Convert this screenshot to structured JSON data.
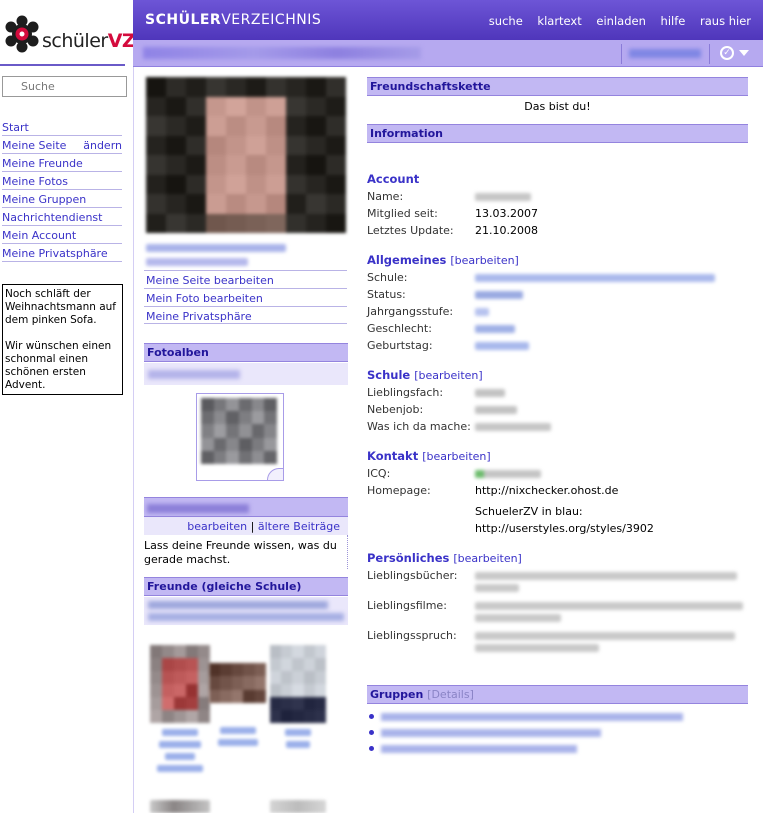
{
  "logo": {
    "prefix": "schüler",
    "suffix": "VZ"
  },
  "search": {
    "placeholder": "Suche"
  },
  "leftnav": {
    "items": [
      {
        "label": "Start"
      },
      {
        "label": "Meine Seite",
        "aside": "ändern"
      },
      {
        "label": "Meine Freunde"
      },
      {
        "label": "Meine Fotos"
      },
      {
        "label": "Meine Gruppen"
      },
      {
        "label": "Nachrichtendienst"
      },
      {
        "label": "Mein Account"
      },
      {
        "label": "Meine Privatsphäre"
      }
    ]
  },
  "note": {
    "para1": "Noch schläft der Weihnachtsmann auf dem pinken Sofa.",
    "para2": "Wir wünschen einen schonmal einen schönen ersten Advent."
  },
  "header": {
    "brand_bold": "SCHÜLER",
    "brand_rest": "VERZEICHNIS",
    "nav": [
      "suche",
      "klartext",
      "einladen",
      "hilfe",
      "raus hier"
    ]
  },
  "profile_links": [
    "Meine Seite bearbeiten",
    "Mein Foto bearbeiten",
    "Meine Privatsphäre"
  ],
  "fotoalben": {
    "title": "Fotoalben"
  },
  "status": {
    "edit_label": "bearbeiten",
    "separator": "|",
    "older_label": "ältere Beiträge",
    "text": "Lass deine Freunde wissen, was du gerade machst."
  },
  "freunde": {
    "title": "Freunde (gleiche Schule)"
  },
  "right": {
    "chain": {
      "title": "Freundschaftskette",
      "text": "Das bist du!"
    },
    "information": {
      "title": "Information"
    },
    "account": {
      "title": "Account",
      "rows": [
        {
          "label": "Name:"
        },
        {
          "label": "Mitglied seit:",
          "value": "13.03.2007"
        },
        {
          "label": "Letztes Update:",
          "value": "21.10.2008"
        }
      ]
    },
    "allgemeines": {
      "title": "Allgemeines",
      "edit": "[bearbeiten]",
      "rows": [
        "Schule:",
        "Status:",
        "Jahrgangsstufe:",
        "Geschlecht:",
        "Geburtstag:"
      ]
    },
    "schule": {
      "title": "Schule",
      "edit": "[bearbeiten]",
      "rows": [
        "Lieblingsfach:",
        "Nebenjob:",
        "Was ich da mache:"
      ]
    },
    "kontakt": {
      "title": "Kontakt",
      "edit": "[bearbeiten]",
      "icq_label": "ICQ:",
      "homepage_label": "Homepage:",
      "homepage_value": "http://nixchecker.ohost.de",
      "extra_line1": "SchuelerZV in blau:",
      "extra_line2": "http://userstyles.org/styles/3902"
    },
    "persoenliches": {
      "title": "Persönliches",
      "edit": "[bearbeiten]",
      "rows": [
        "Lieblingsbücher:",
        "Lieblingsfilme:",
        "Lieblingsspruch:"
      ]
    },
    "gruppen": {
      "title": "Gruppen",
      "details": "[Details]"
    }
  },
  "colors": {
    "accent": "#5b40c7",
    "section_header": "#c2b8f3",
    "link": "#3a32c8",
    "logo_red": "#d40b3d"
  }
}
